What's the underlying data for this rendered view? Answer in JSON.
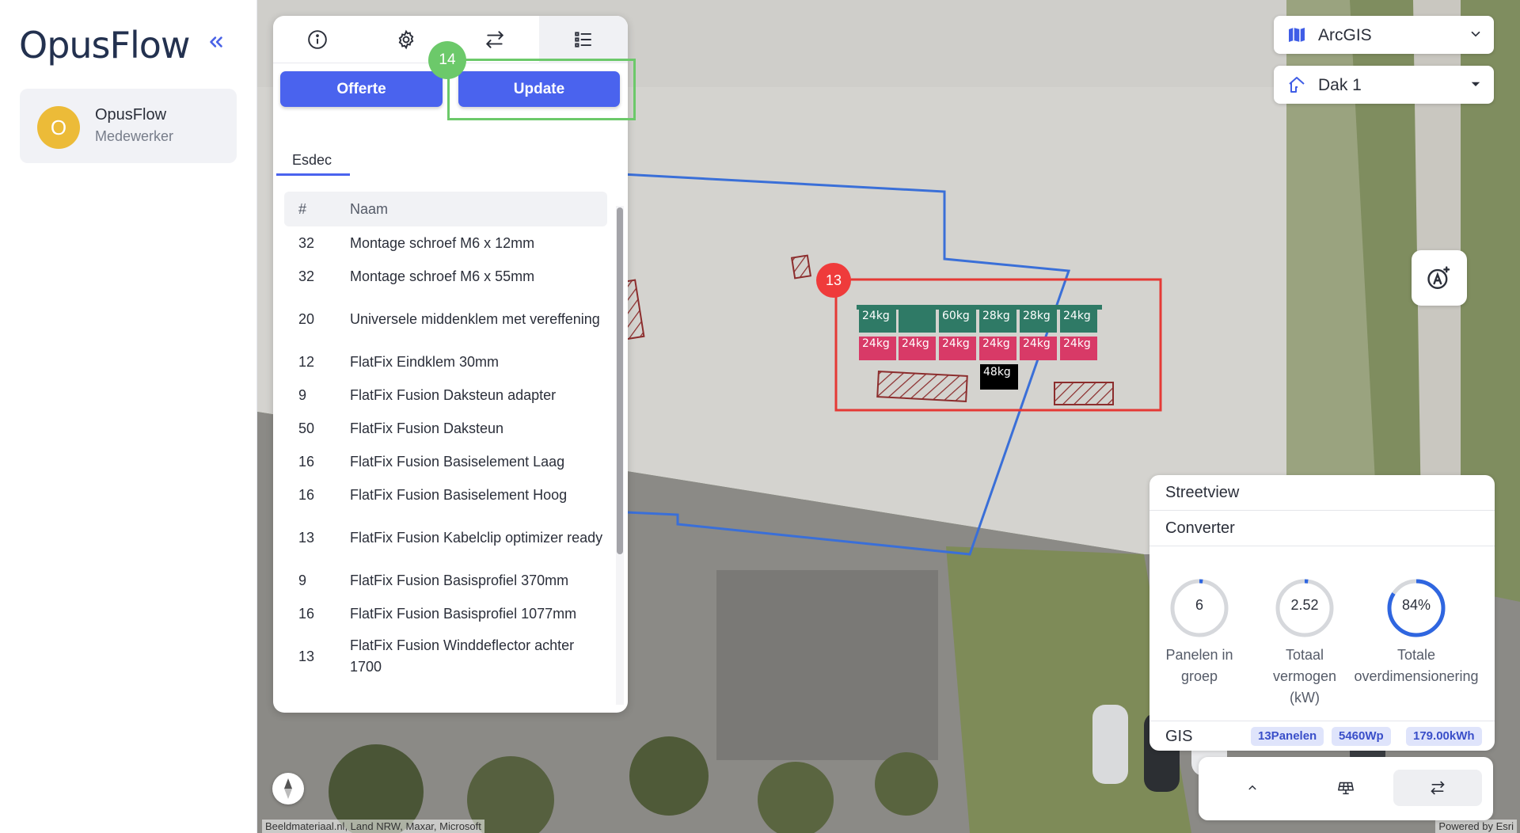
{
  "app": {
    "logo": "OpusFlow",
    "collapse_icon": "chevrons-left-icon"
  },
  "user": {
    "initial": "O",
    "name": "OpusFlow",
    "role": "Medewerker"
  },
  "panel": {
    "tabs": [
      {
        "icon": "info-icon"
      },
      {
        "icon": "gear-icon"
      },
      {
        "icon": "arrows-swap-icon"
      },
      {
        "icon": "list-icon",
        "active": true
      }
    ],
    "offerte_label": "Offerte",
    "update_label": "Update",
    "update_badge": "14",
    "subtab": "Esdec",
    "columns": {
      "qty": "#",
      "name": "Naam"
    },
    "items": [
      {
        "qty": "32",
        "name": "Montage schroef M6 x 12mm"
      },
      {
        "qty": "32",
        "name": "Montage schroef M6 x 55mm"
      },
      {
        "qty": "20",
        "name": "Universele middenklem met vereffening"
      },
      {
        "qty": "12",
        "name": "FlatFix Eindklem 30mm"
      },
      {
        "qty": "9",
        "name": "FlatFix Fusion Daksteun adapter"
      },
      {
        "qty": "50",
        "name": "FlatFix Fusion Daksteun"
      },
      {
        "qty": "16",
        "name": "FlatFix Fusion Basiselement Laag"
      },
      {
        "qty": "16",
        "name": "FlatFix Fusion Basiselement Hoog"
      },
      {
        "qty": "13",
        "name": "FlatFix Fusion Kabelclip optimizer ready"
      },
      {
        "qty": "9",
        "name": "FlatFix Fusion Basisprofiel 370mm"
      },
      {
        "qty": "16",
        "name": "FlatFix Fusion Basisprofiel 1077mm"
      },
      {
        "qty": "13",
        "name": "FlatFix Fusion Winddeflector achter 1700"
      }
    ]
  },
  "map": {
    "basemap": "ArcGIS",
    "roof": "Dak 1",
    "group_badge": "13",
    "top_row_weights": [
      "24kg",
      "",
      "60kg",
      "28kg",
      "28kg",
      "24kg"
    ],
    "bottom_row_weights": [
      "24kg",
      "24kg",
      "24kg",
      "24kg",
      "24kg",
      "24kg"
    ],
    "extra_weight": "48kg",
    "attribution": "Beeldmateriaal.nl, Land NRW, Maxar, Microsoft",
    "powered_by": "Powered by Esri",
    "colors": {
      "roof_outline": "#3a6fd8",
      "group_outline": "#e53935",
      "panel_top": "#2f7a66",
      "panel_bottom": "#d83a67"
    }
  },
  "info": {
    "streetview": "Streetview",
    "converter": "Converter",
    "gauges": [
      {
        "value": "6",
        "label": "Panelen in groep",
        "fill": 0.02
      },
      {
        "value": "2.52",
        "label": "Totaal vermogen (kW)",
        "fill": 0.02
      },
      {
        "value": "84%",
        "label": "Totale overdimensionering",
        "fill": 0.84
      }
    ],
    "gis_label": "GIS",
    "chips": [
      "13Panelen",
      "5460Wp",
      "179.00kWh"
    ]
  },
  "toolbar": {
    "buttons": [
      {
        "icon": "chevron-up-icon"
      },
      {
        "icon": "solar-panel-icon"
      },
      {
        "icon": "arrows-swap-icon",
        "active": true
      }
    ]
  }
}
